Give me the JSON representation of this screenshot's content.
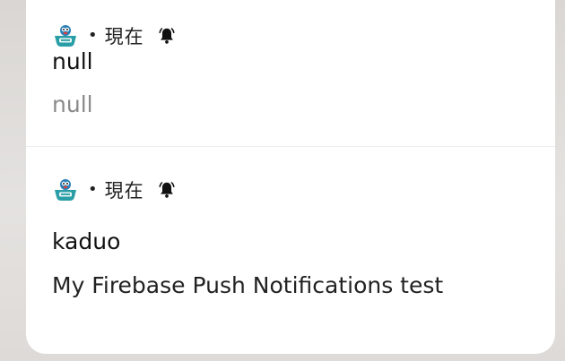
{
  "notifications": [
    {
      "app_icon": "kaduo-app-icon",
      "separator": "•",
      "time": "現在",
      "alert_icon": "bell-ringing-icon",
      "title": "null",
      "body": "null"
    },
    {
      "app_icon": "kaduo-app-icon",
      "separator": "•",
      "time": "現在",
      "alert_icon": "bell-ringing-icon",
      "title": "kaduo",
      "body": "My Firebase Push Notifications test"
    }
  ],
  "colors": {
    "card_background": "#ffffff",
    "title_text": "#111111",
    "muted_body_text": "#8a8a8a",
    "body_text": "#222222",
    "icon_teal": "#2a9ea6"
  }
}
